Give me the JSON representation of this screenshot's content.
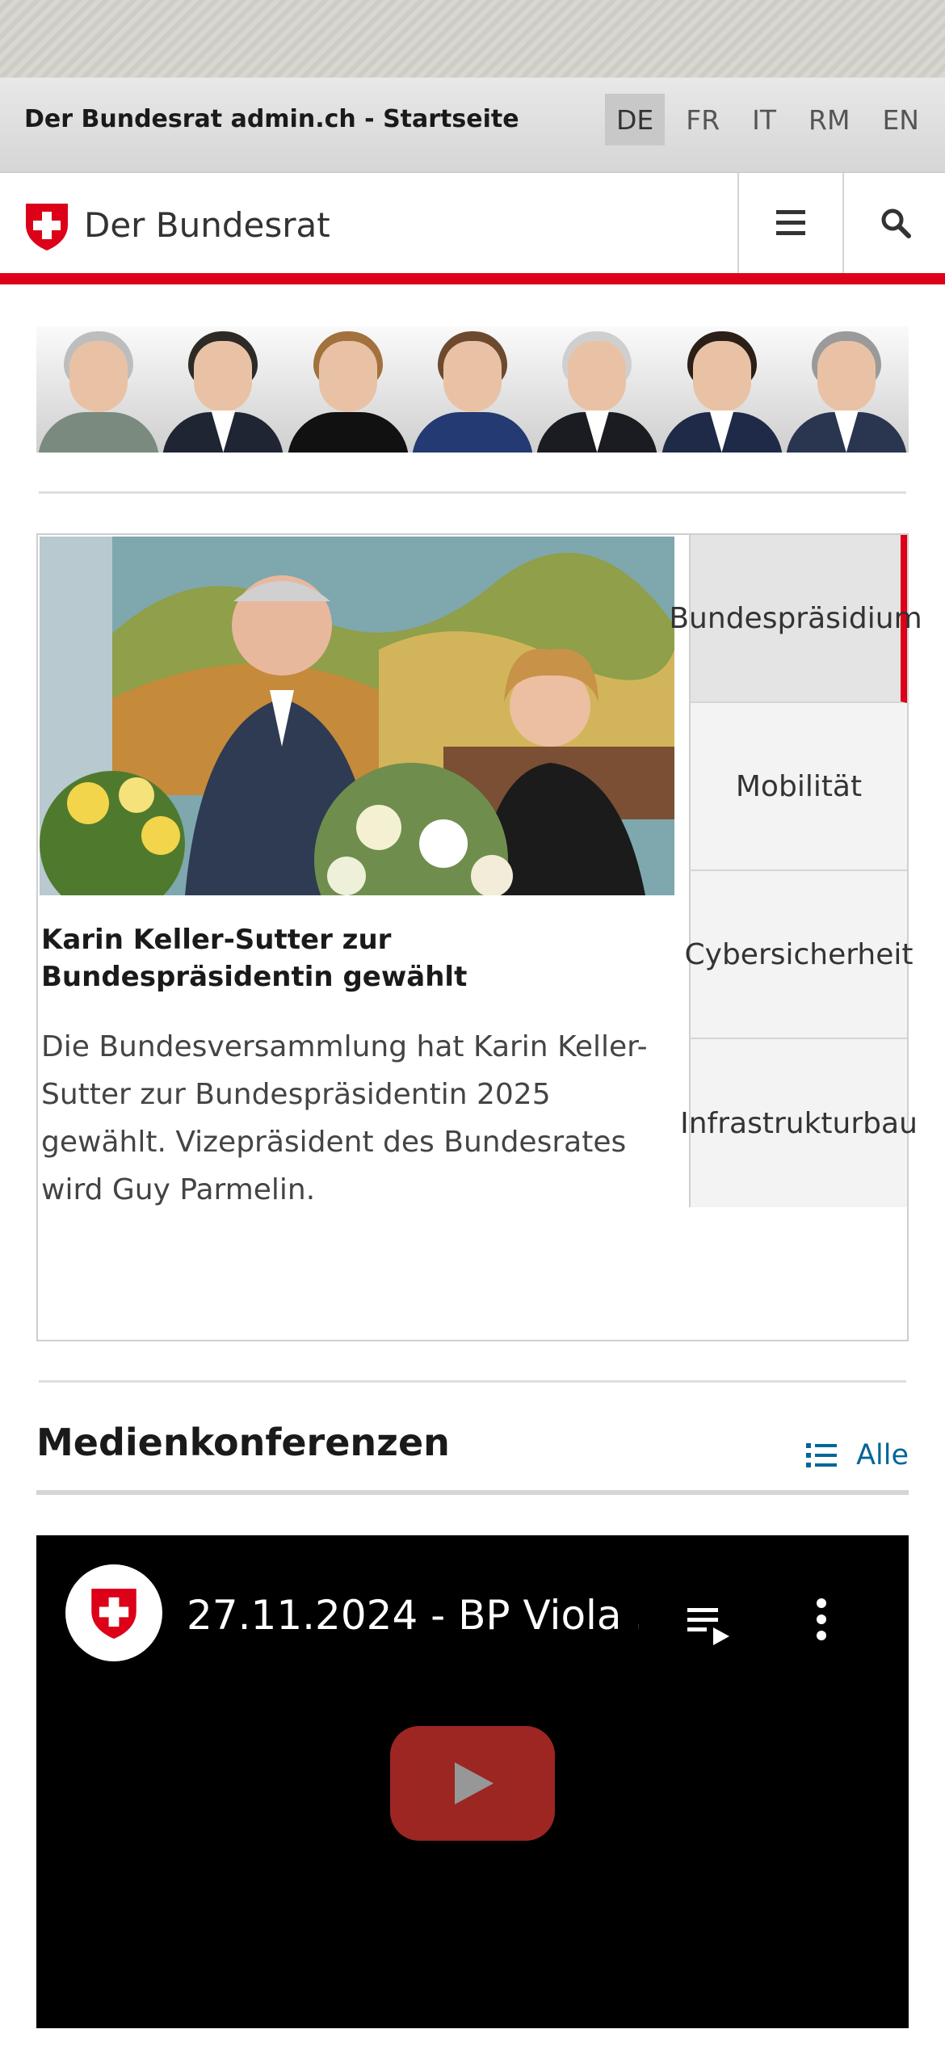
{
  "topbar": {
    "title": "Der Bundesrat admin.ch - Startseite",
    "languages": [
      {
        "code": "DE",
        "active": true
      },
      {
        "code": "FR",
        "active": false
      },
      {
        "code": "IT",
        "active": false
      },
      {
        "code": "RM",
        "active": false
      },
      {
        "code": "EN",
        "active": false
      }
    ]
  },
  "header": {
    "brand": "Der Bundesrat",
    "menu_icon": "hamburger-menu-icon",
    "search_icon": "search-icon",
    "accent_color": "#dc0018"
  },
  "portraits": {
    "count": 7
  },
  "carousel": {
    "news_title": "Karin Keller-Sutter zur Bundespräsidentin gewählt",
    "news_text": "Die Bundesversammlung hat Karin Keller-Sutter zur Bundespräsidentin 2025 gewählt. Vizepräsident des Bundesrates wird Guy Parmelin.",
    "tabs": [
      {
        "label": "Bundespräsidium",
        "active": true
      },
      {
        "label": "Mobilität",
        "active": false
      },
      {
        "label": "Cybersicherheit",
        "active": false
      },
      {
        "label": "Infrastrukturbau",
        "active": false
      }
    ]
  },
  "media": {
    "section_title": "Medienkonferenzen",
    "all_link": "Alle",
    "list_icon": "list-icon",
    "video": {
      "title": "27.11.2024 - BP Viola ...",
      "playlist_icon": "playlist-icon",
      "more_icon": "more-vertical-icon",
      "play_icon": "play-icon"
    }
  }
}
